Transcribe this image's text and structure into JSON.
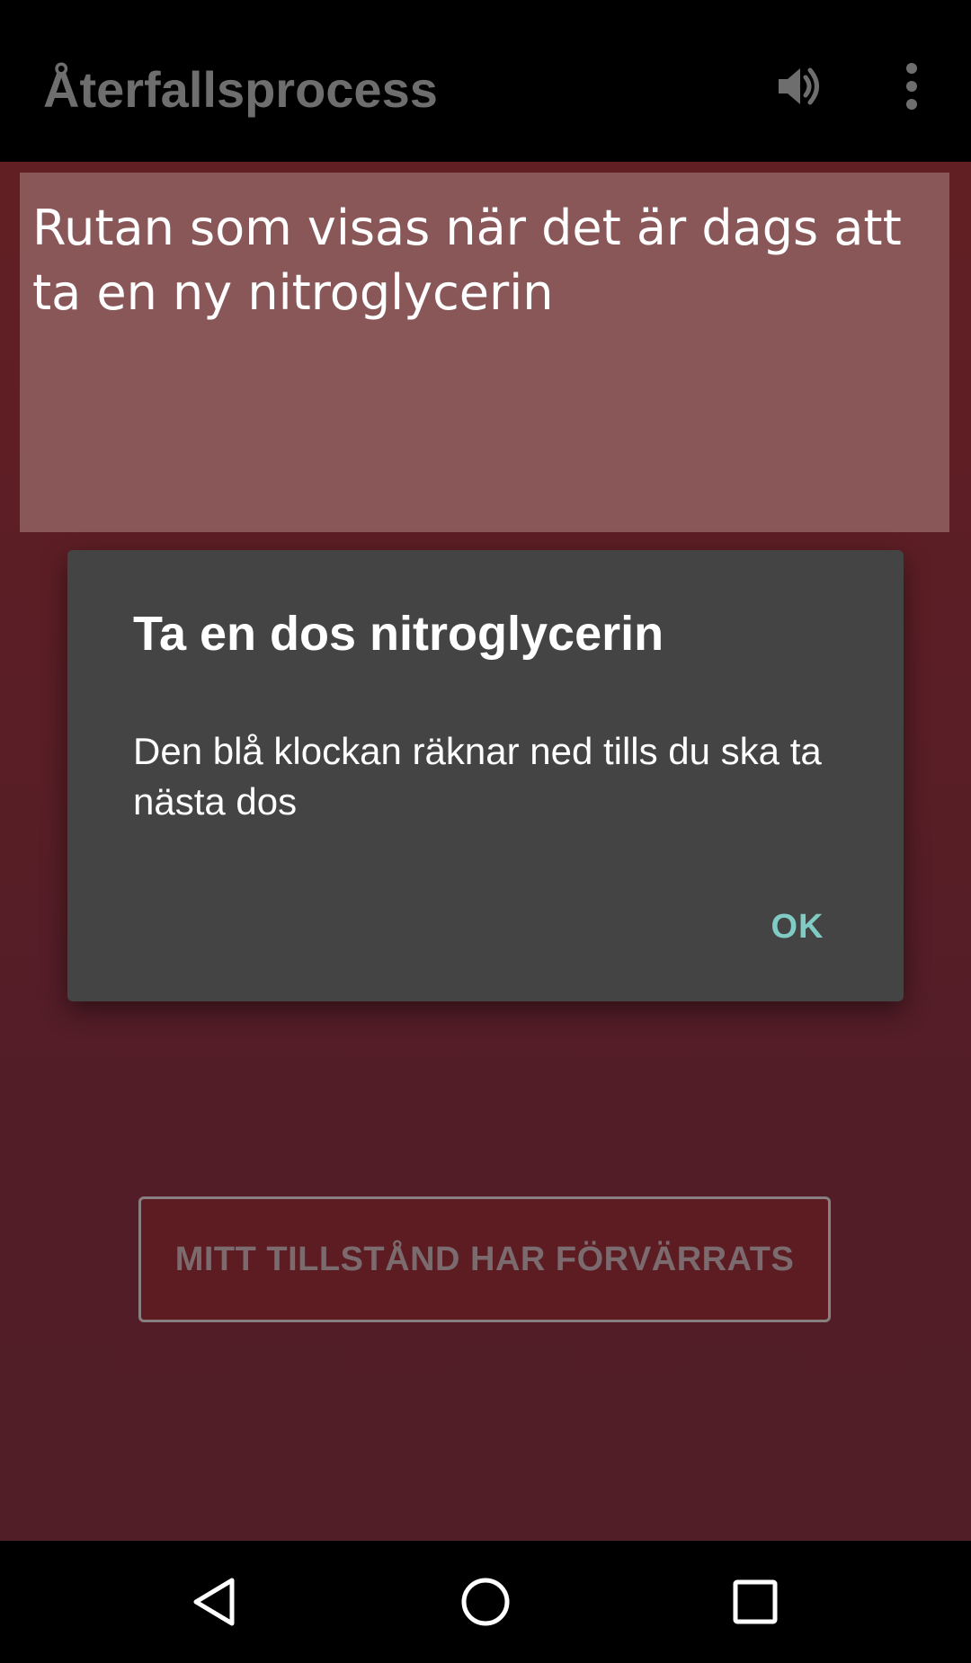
{
  "app_bar": {
    "title": "Återfallsprocess",
    "volume_icon": "volume-up-icon",
    "overflow_icon": "more-vert-icon"
  },
  "main": {
    "info_text": "Rutan som visas när det är dags att ta en ny nitroglycerin",
    "worsened_button_label": "MITT TILLSTÅND HAR FÖRVÄRRATS"
  },
  "dialog": {
    "title": "Ta en dos nitroglycerin",
    "message": "Den blå klockan räknar ned tills du ska ta nästa dos",
    "ok_label": "OK"
  },
  "nav_bar": {
    "back_icon": "back-triangle-icon",
    "home_icon": "home-circle-icon",
    "recents_icon": "recents-square-icon"
  },
  "colors": {
    "background": "#5a1e26",
    "info_box": "#8a5759",
    "dialog": "#444444",
    "dialog_accent": "#80cbc4"
  }
}
